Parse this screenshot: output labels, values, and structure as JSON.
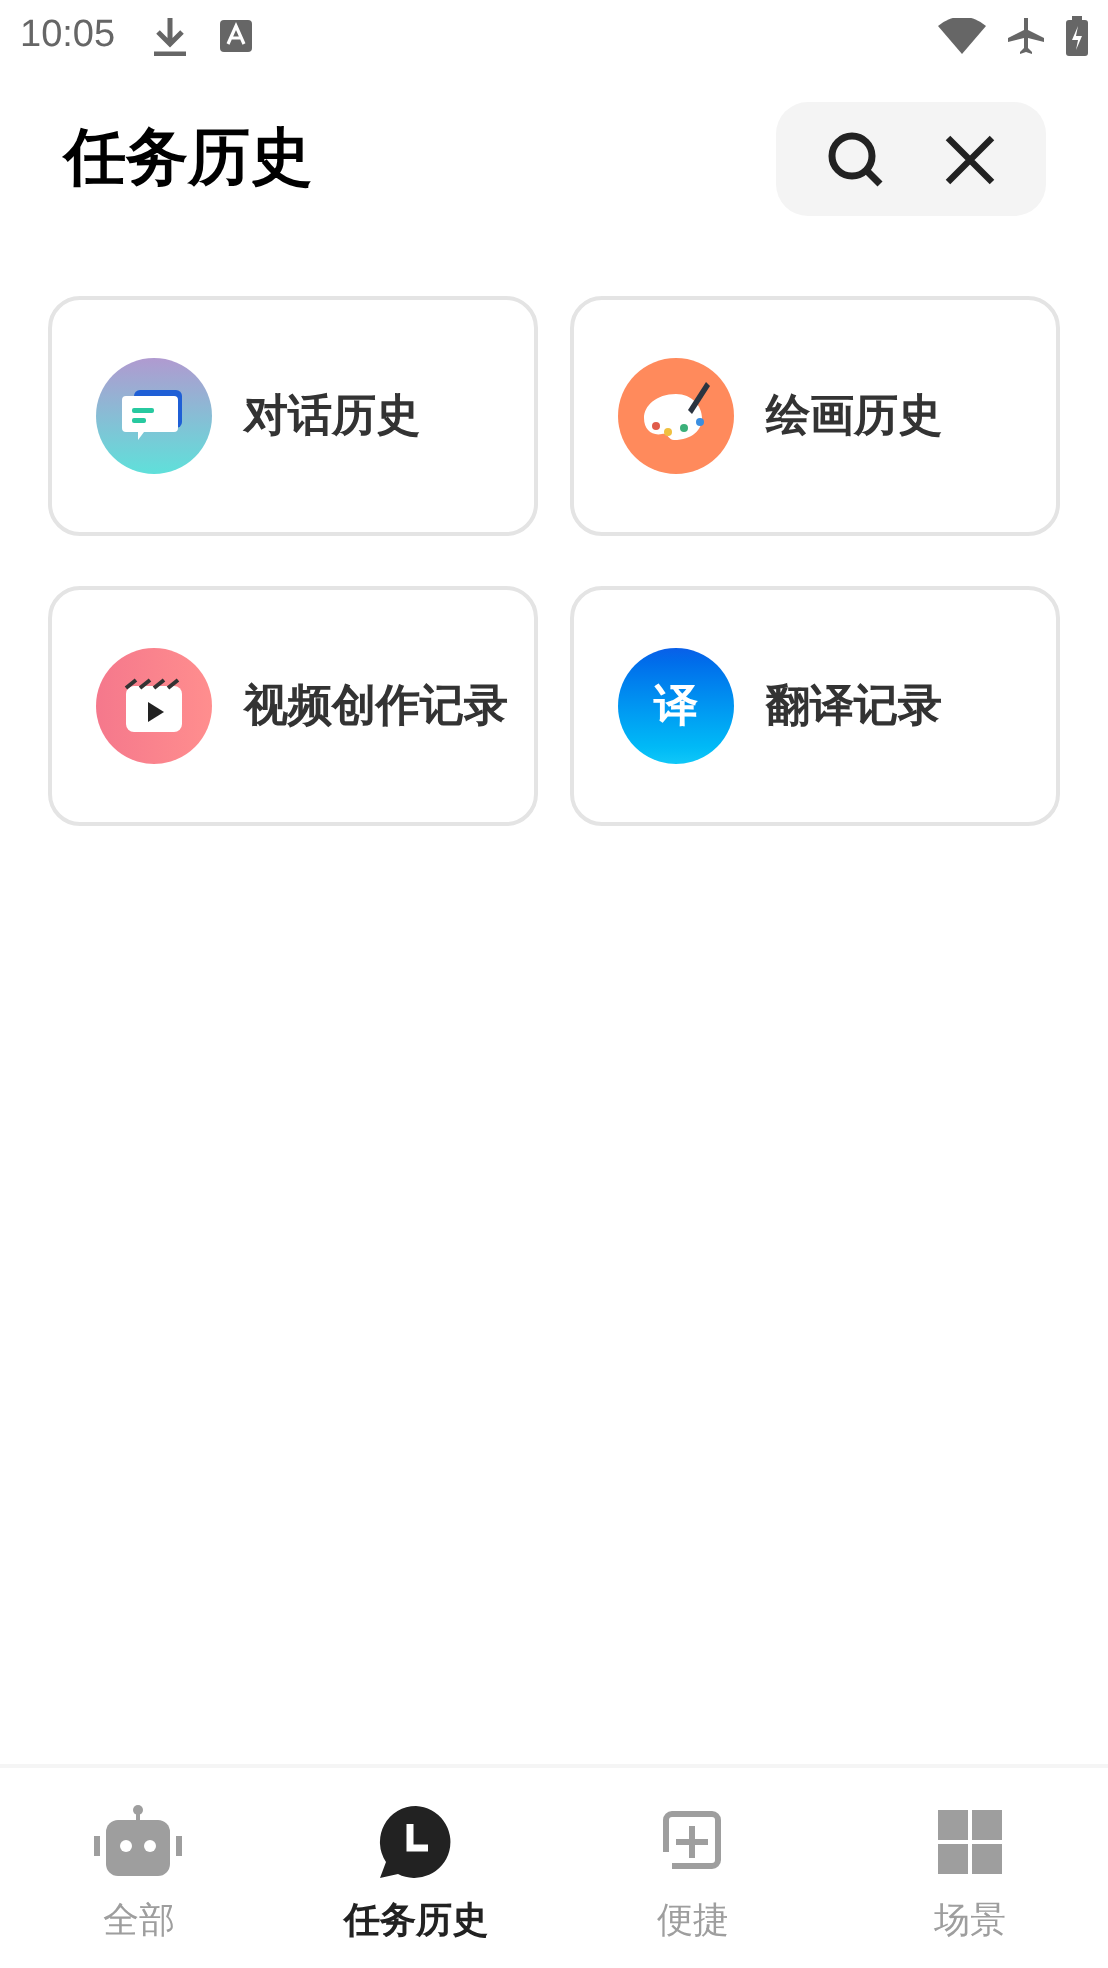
{
  "status_bar": {
    "time": "10:05"
  },
  "header": {
    "title": "任务历史"
  },
  "cards": [
    {
      "kind": "chat",
      "label": "对话历史"
    },
    {
      "kind": "palette",
      "label": "绘画历史"
    },
    {
      "kind": "video",
      "label": "视频创作记录"
    },
    {
      "kind": "translate",
      "label": "翻译记录",
      "icon_text": "译"
    }
  ],
  "bottom_nav": [
    {
      "kind": "robot",
      "label": "全部",
      "selected": false
    },
    {
      "kind": "history",
      "label": "任务历史",
      "selected": true
    },
    {
      "kind": "shortcut",
      "label": "便捷",
      "selected": false
    },
    {
      "kind": "scenes",
      "label": "场景",
      "selected": false
    }
  ]
}
